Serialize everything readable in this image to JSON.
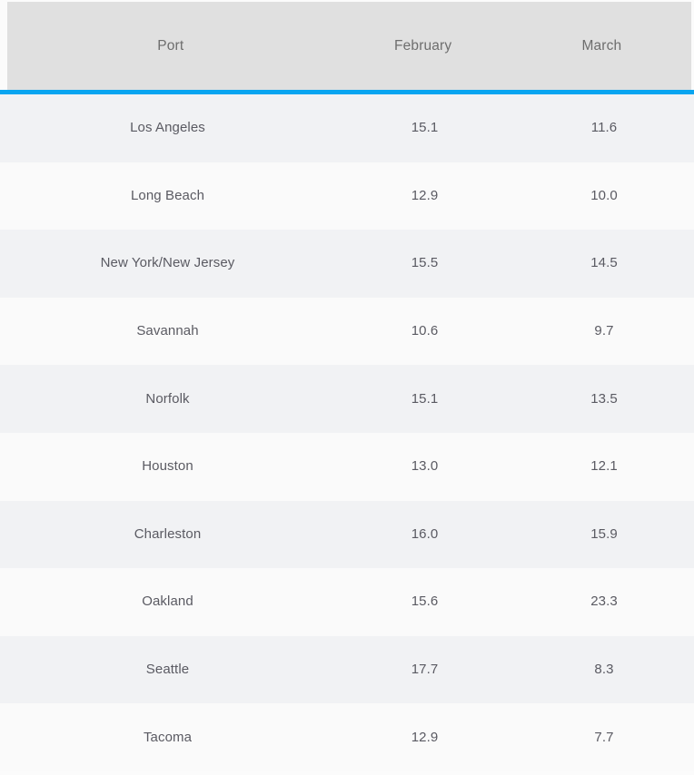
{
  "theme": {
    "accent_color": "#09A5F0",
    "header_background": "#E0E0E0",
    "row_odd_background": "#F1F2F4",
    "row_even_background": "#FAFAFA",
    "header_text_color": "#6E6E6E",
    "cell_text_color": "#5A5A62"
  },
  "table": {
    "columns": [
      {
        "key": "port",
        "label": "Port",
        "align": "center"
      },
      {
        "key": "february",
        "label": "February",
        "align": "center"
      },
      {
        "key": "march",
        "label": "March",
        "align": "center"
      }
    ],
    "rows": [
      {
        "port": "Los Angeles",
        "february": "15.1",
        "march": "11.6"
      },
      {
        "port": "Long Beach",
        "february": "12.9",
        "march": "10.0"
      },
      {
        "port": "New York/New Jersey",
        "february": "15.5",
        "march": "14.5"
      },
      {
        "port": "Savannah",
        "february": "10.6",
        "march": "9.7"
      },
      {
        "port": "Norfolk",
        "february": "15.1",
        "march": "13.5"
      },
      {
        "port": "Houston",
        "february": "13.0",
        "march": "12.1"
      },
      {
        "port": "Charleston",
        "february": "16.0",
        "march": "15.9"
      },
      {
        "port": "Oakland",
        "february": "15.6",
        "march": "23.3"
      },
      {
        "port": "Seattle",
        "february": "17.7",
        "march": "8.3"
      },
      {
        "port": "Tacoma",
        "february": "12.9",
        "march": "7.7"
      }
    ]
  },
  "chart_data": {
    "type": "table",
    "title": "",
    "categories": [
      "Los Angeles",
      "Long Beach",
      "New York/New Jersey",
      "Savannah",
      "Norfolk",
      "Houston",
      "Charleston",
      "Oakland",
      "Seattle",
      "Tacoma"
    ],
    "series": [
      {
        "name": "February",
        "values": [
          15.1,
          12.9,
          15.5,
          10.6,
          15.1,
          13.0,
          16.0,
          15.6,
          17.7,
          12.9
        ]
      },
      {
        "name": "March",
        "values": [
          11.6,
          10.0,
          14.5,
          9.7,
          13.5,
          12.1,
          15.9,
          23.3,
          8.3,
          7.7
        ]
      }
    ],
    "xlabel": "Port",
    "ylabel": "",
    "legend": [
      "February",
      "March"
    ],
    "grid": false
  }
}
